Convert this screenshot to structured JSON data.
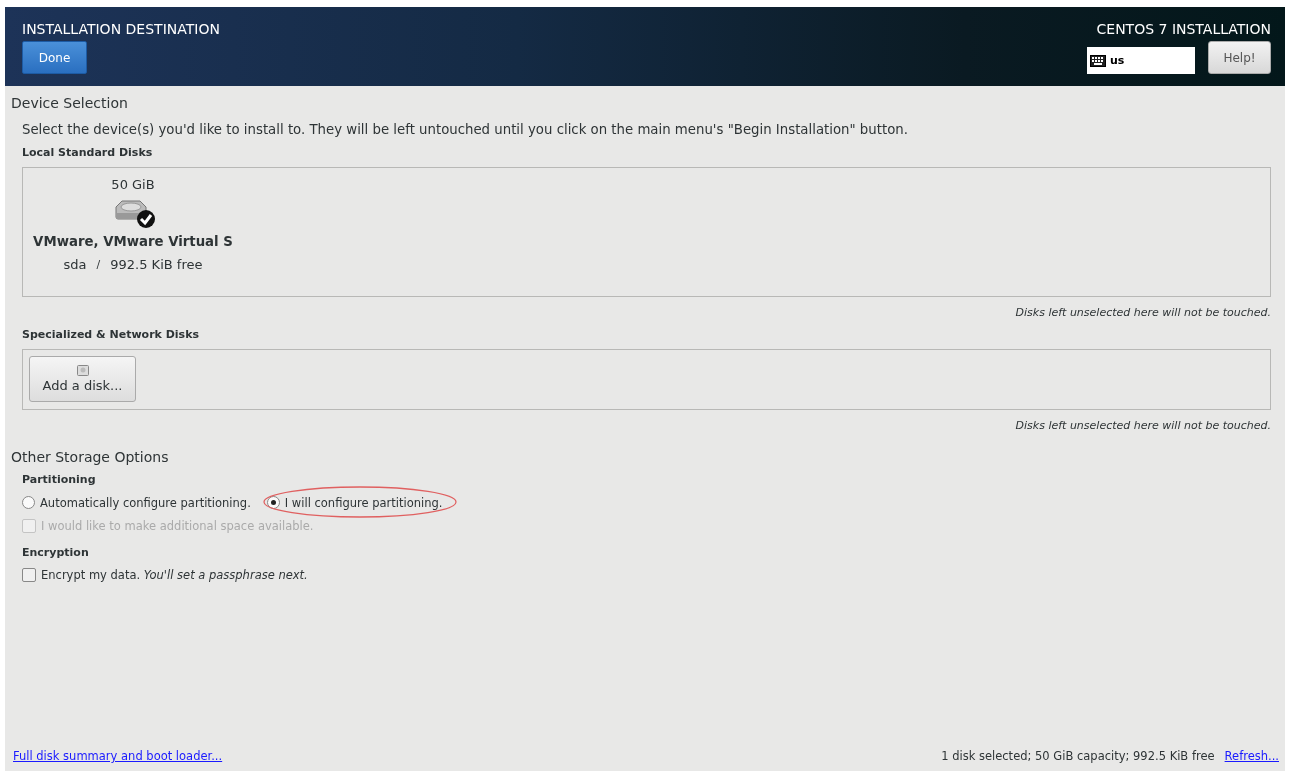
{
  "header": {
    "title": "INSTALLATION DESTINATION",
    "done_button": "Done",
    "product": "CENTOS 7 INSTALLATION",
    "keyboard_layout": "us",
    "help_button": "Help!"
  },
  "device_selection": {
    "heading": "Device Selection",
    "intro": "Select the device(s) you'd like to install to.  They will be left untouched until you click on the main menu's \"Begin Installation\" button.",
    "local_disks": {
      "heading": "Local Standard Disks",
      "disks": [
        {
          "size": "50 GiB",
          "name": "VMware, VMware Virtual S",
          "device": "sda",
          "separator": "/",
          "free": "992.5 KiB free",
          "selected": true
        }
      ],
      "note": "Disks left unselected here will not be touched."
    },
    "network_disks": {
      "heading": "Specialized & Network Disks",
      "add_button": "Add a disk...",
      "note": "Disks left unselected here will not be touched."
    }
  },
  "other_storage": {
    "heading": "Other Storage Options",
    "partitioning": {
      "heading": "Partitioning",
      "options": [
        {
          "label": "Automatically configure partitioning.",
          "selected": false,
          "highlighted": false
        },
        {
          "label": "I will configure partitioning.",
          "selected": true,
          "highlighted": true
        }
      ],
      "reclaim": {
        "label": "I would like to make additional space available.",
        "checked": false,
        "disabled": true
      }
    },
    "encryption": {
      "heading": "Encryption",
      "label": "Encrypt my data. *You'll set a passphrase next.*",
      "checked": false,
      "disabled": false
    }
  },
  "footer": {
    "summary_link": "Full disk summary and boot loader...",
    "status": "1 disk selected; 50 GiB capacity; 992.5 KiB free",
    "refresh_link": "Refresh..."
  }
}
